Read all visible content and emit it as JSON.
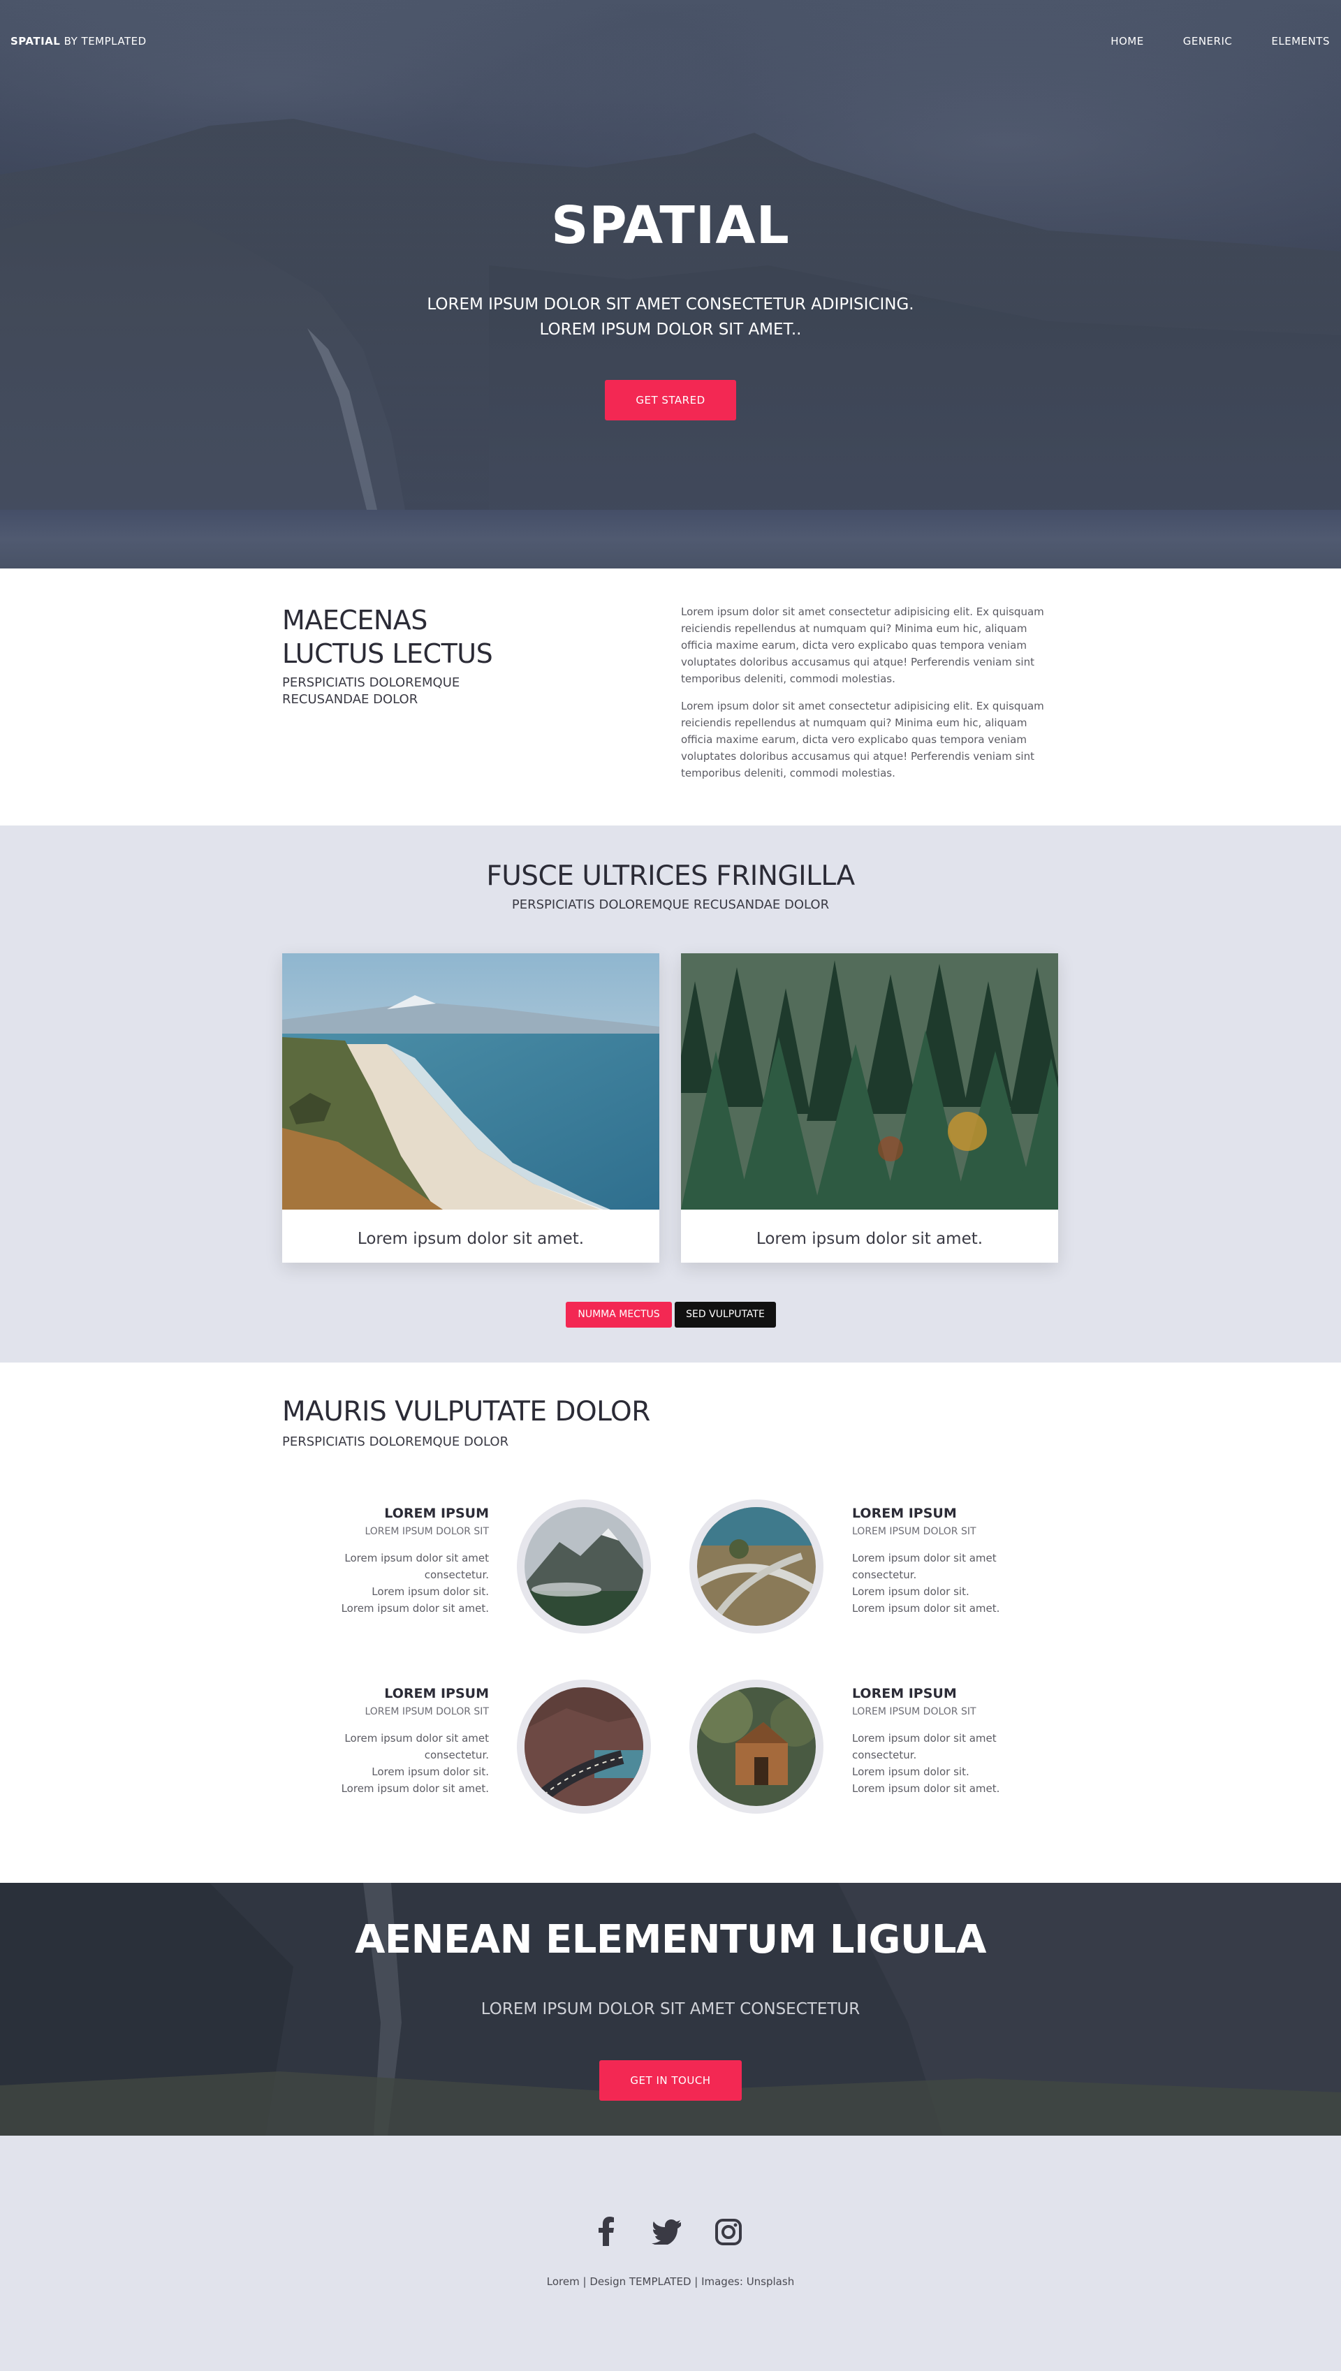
{
  "topbar": {
    "logo_bold": "SPATIAL",
    "logo_rest": " BY TEMPLATED",
    "nav": [
      "HOME",
      "GENERIC",
      "ELEMENTS"
    ]
  },
  "hero": {
    "title": "SPATIAL",
    "subtitle_line1": "LOREM IPSUM DOLOR SIT AMET CONSECTETUR ADIPISICING.",
    "subtitle_line2": "LOREM IPSUM DOLOR SIT AMET..",
    "button": "GET STARED"
  },
  "intro": {
    "heading_line1": "MAECENAS",
    "heading_line2": "LUCTUS LECTUS",
    "sub_line1": "PERSPICIATIS DOLOREMQUE",
    "sub_line2": "RECUSANDAE DOLOR",
    "paragraphs": [
      "Lorem ipsum dolor sit amet consectetur adipisicing elit. Ex quisquam reiciendis repellendus at numquam qui? Minima eum hic, aliquam officia maxime earum, dicta vero explicabo quas tempora veniam voluptates doloribus accusamus qui atque! Perferendis veniam sint temporibus deleniti, commodi molestias.",
      "Lorem ipsum dolor sit amet consectetur adipisicing elit. Ex quisquam reiciendis repellendus at numquam qui? Minima eum hic, aliquam officia maxime earum, dicta vero explicabo quas tempora veniam voluptates doloribus accusamus qui atque! Perferendis veniam sint temporibus deleniti, commodi molestias."
    ]
  },
  "gallery": {
    "title": "FUSCE ULTRICES FRINGILLA",
    "subtitle": "PERSPICIATIS DOLOREMQUE RECUSANDAE DOLOR",
    "cards": [
      {
        "caption": "Lorem ipsum dolor sit amet."
      },
      {
        "caption": "Lorem ipsum dolor sit amet."
      }
    ],
    "tabs": [
      "NUMMA MECTUS",
      "SED VULPUTATE"
    ]
  },
  "features": {
    "title": "MAURIS VULPUTATE DOLOR",
    "subtitle": "PERSPICIATIS DOLOREMQUE DOLOR",
    "items": [
      {
        "title": "LOREM IPSUM",
        "sub": "LOREM IPSUM DOLOR SIT",
        "lines": [
          "Lorem ipsum dolor sit amet consectetur.",
          "Lorem ipsum dolor sit.",
          "Lorem ipsum dolor sit amet."
        ]
      },
      {
        "title": "LOREM IPSUM",
        "sub": "LOREM IPSUM DOLOR SIT",
        "lines": [
          "Lorem ipsum dolor sit amet consectetur.",
          "Lorem ipsum dolor sit.",
          "Lorem ipsum dolor sit amet."
        ]
      },
      {
        "title": "LOREM IPSUM",
        "sub": "LOREM IPSUM DOLOR SIT",
        "lines": [
          "Lorem ipsum dolor sit amet consectetur.",
          "Lorem ipsum dolor sit.",
          "Lorem ipsum dolor sit amet."
        ]
      },
      {
        "title": "LOREM IPSUM",
        "sub": "LOREM IPSUM DOLOR SIT",
        "lines": [
          "Lorem ipsum dolor sit amet consectetur.",
          "Lorem ipsum dolor sit.",
          "Lorem ipsum dolor sit amet."
        ]
      }
    ]
  },
  "cta": {
    "title": "AENEAN ELEMENTUM LIGULA",
    "subtitle": "LOREM IPSUM DOLOR SIT AMET CONSECTETUR",
    "button": "GET IN TOUCH"
  },
  "footer": {
    "icons": [
      "facebook-icon",
      "twitter-icon",
      "instagram-icon"
    ],
    "credit": "Lorem | Design TEMPLATED | Images: Unsplash"
  },
  "colors": {
    "accent": "#f32853",
    "section_bg": "#e1e3ec",
    "dark_text": "#2b2b36"
  }
}
